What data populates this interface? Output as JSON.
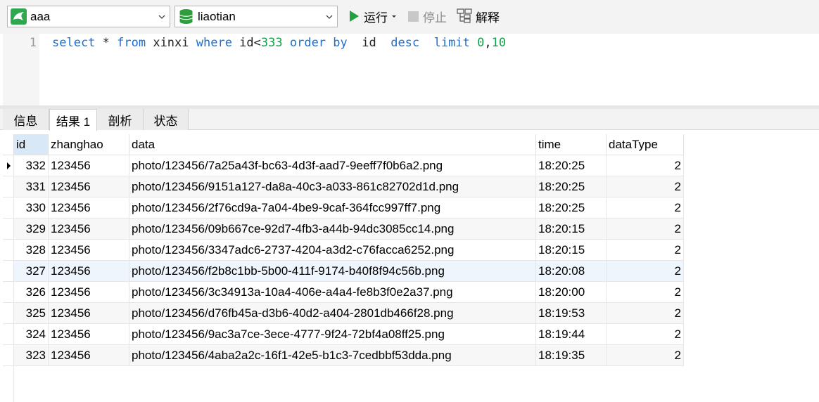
{
  "toolbar": {
    "connection": "aaa",
    "database": "liaotian",
    "run_label": "运行",
    "stop_label": "停止",
    "explain_label": "解释",
    "colors": {
      "run": "#20a040",
      "db": "#2e9e3c"
    }
  },
  "editor": {
    "line_number": "1",
    "tokens": [
      {
        "t": "select",
        "c": "kw"
      },
      {
        "t": " * ",
        "c": "plain"
      },
      {
        "t": "from",
        "c": "kw"
      },
      {
        "t": " xinxi ",
        "c": "plain"
      },
      {
        "t": "where",
        "c": "kw"
      },
      {
        "t": " id<",
        "c": "plain"
      },
      {
        "t": "333",
        "c": "num"
      },
      {
        "t": " ",
        "c": "plain"
      },
      {
        "t": "order",
        "c": "kw"
      },
      {
        "t": " ",
        "c": "plain"
      },
      {
        "t": "by",
        "c": "kw"
      },
      {
        "t": "  id  ",
        "c": "plain"
      },
      {
        "t": "desc",
        "c": "kw"
      },
      {
        "t": "  ",
        "c": "plain"
      },
      {
        "t": "limit",
        "c": "kw"
      },
      {
        "t": " ",
        "c": "plain"
      },
      {
        "t": "0",
        "c": "num"
      },
      {
        "t": ",",
        "c": "plain"
      },
      {
        "t": "10",
        "c": "num"
      }
    ]
  },
  "tabs": [
    {
      "label": "信息",
      "active": false
    },
    {
      "label": "结果 1",
      "active": true
    },
    {
      "label": "剖析",
      "active": false
    },
    {
      "label": "状态",
      "active": false
    }
  ],
  "result": {
    "columns": [
      "id",
      "zhanghao",
      "data",
      "time",
      "dataType"
    ],
    "rows": [
      [
        "332",
        "123456",
        "photo/123456/7a25a43f-bc63-4d3f-aad7-9eeff7f0b6a2.png",
        "18:20:25",
        "2"
      ],
      [
        "331",
        "123456",
        "photo/123456/9151a127-da8a-40c3-a033-861c82702d1d.png",
        "18:20:25",
        "2"
      ],
      [
        "330",
        "123456",
        "photo/123456/2f76cd9a-7a04-4be9-9caf-364fcc997ff7.png",
        "18:20:25",
        "2"
      ],
      [
        "329",
        "123456",
        "photo/123456/09b667ce-92d7-4fb3-a44b-94dc3085cc14.png",
        "18:20:15",
        "2"
      ],
      [
        "328",
        "123456",
        "photo/123456/3347adc6-2737-4204-a3d2-c76facca6252.png",
        "18:20:15",
        "2"
      ],
      [
        "327",
        "123456",
        "photo/123456/f2b8c1bb-5b00-411f-9174-b40f8f94c56b.png",
        "18:20:08",
        "2"
      ],
      [
        "326",
        "123456",
        "photo/123456/3c34913a-10a4-406e-a4a4-fe8b3f0e2a37.png",
        "18:20:00",
        "2"
      ],
      [
        "325",
        "123456",
        "photo/123456/d76fb45a-d3b6-40d2-a404-2801db466f28.png",
        "18:19:53",
        "2"
      ],
      [
        "324",
        "123456",
        "photo/123456/9ac3a7ce-3ece-4777-9f24-72bf4a08ff25.png",
        "18:19:44",
        "2"
      ],
      [
        "323",
        "123456",
        "photo/123456/4aba2a2c-16f1-42e5-b1c3-7cedbbf53dda.png",
        "18:19:35",
        "2"
      ]
    ],
    "current_row": 0,
    "highlight_row": 5
  }
}
